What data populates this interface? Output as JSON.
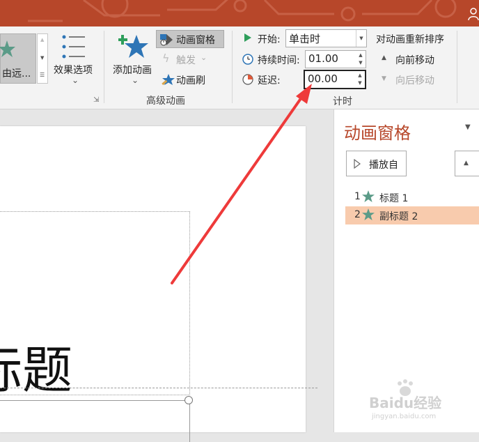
{
  "ribbon": {
    "gallery_item_label": "由远...",
    "effect_options": {
      "label": "效果选项",
      "dropdown": "⌄"
    },
    "add_animation": {
      "label": "添加动画",
      "dropdown": "⌄"
    },
    "animation_pane_btn": "动画窗格",
    "trigger": "触发",
    "trigger_arrow": "⌄",
    "animation_painter": "动画刷",
    "advanced_group": "高级动画",
    "timing": {
      "start_label": "开始:",
      "start_value": "单击时",
      "duration_label": "持续时间:",
      "duration_value": "01.00",
      "delay_label": "延迟:",
      "delay_value": "00.00",
      "group_label": "计时"
    },
    "reorder": {
      "title": "对动画重新排序",
      "move_earlier": "向前移动",
      "move_later": "向后移动"
    }
  },
  "slide": {
    "title_text": "标题"
  },
  "animation_pane": {
    "title": "动画窗格",
    "play_button": "播放自",
    "items": [
      {
        "number": "1",
        "label": "标题 1",
        "selected": false
      },
      {
        "number": "2",
        "label": "副标题 2",
        "selected": true
      }
    ]
  },
  "watermark": {
    "brand": "Baidu经验",
    "url": "jingyan.baidu.com"
  },
  "colors": {
    "title_bar": "#b7472a",
    "pane_title": "#b7472a",
    "star_green": "#5b9b88",
    "selected_row": "#f8cbad",
    "arrow_red": "#ee3a3a"
  }
}
